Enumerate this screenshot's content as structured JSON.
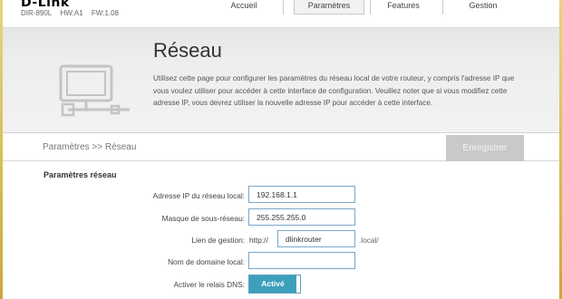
{
  "header": {
    "brand": "D-Link",
    "model": "DIR-890L",
    "hw": "HW:A1",
    "fw": "FW:1.08",
    "tabs": [
      "Accueil",
      "Paramètres",
      "Features",
      "Gestion"
    ],
    "active_tab": "Paramètres"
  },
  "banner": {
    "title": "Réseau",
    "description": "Utilisez cette page pour configurer les paramètres du réseau local de votre routeur, y compris l'adresse IP que vous voulez utiliser pour accéder à cette interface de configuration. Veuillez noter que si vous modifiez cette adresse IP, vous devrez utiliser la nouvelle adresse IP pour accéder à cette interface.",
    "icon": "network-computer-icon"
  },
  "toolbar": {
    "breadcrumb": "Paramètres >> Réseau",
    "save_label": "Enregistrer"
  },
  "form": {
    "section_title": "Paramètres réseau",
    "ip_label": "Adresse IP du réseau local:",
    "ip_value": "192.168.1.1",
    "mask_label": "Masque de sous-réseau:",
    "mask_value": "255.255.255.0",
    "mgmt_label": "Lien de gestion:",
    "mgmt_prefix": "http://",
    "mgmt_value": "dlinkrouter",
    "mgmt_suffix": ".local/",
    "domain_label": "Nom de domaine local:",
    "domain_value": "",
    "dns_label": "Activer le relais DNS:",
    "dns_state": "Activé"
  },
  "colors": {
    "accent": "#3e9fbd",
    "field_border": "#7aa7c9",
    "save_disabled": "#c9c9c9",
    "frame": "#d9bf55"
  }
}
